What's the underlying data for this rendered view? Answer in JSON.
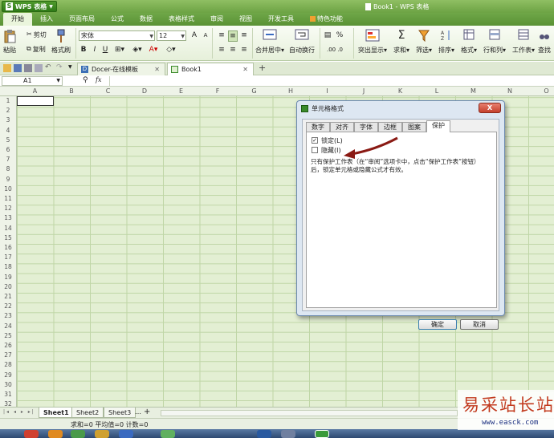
{
  "app": {
    "button_label": "WPS 表格",
    "window_title": "Book1 - WPS 表格"
  },
  "menu": [
    {
      "label": "开始"
    },
    {
      "label": "插入"
    },
    {
      "label": "页面布局"
    },
    {
      "label": "公式"
    },
    {
      "label": "数据"
    },
    {
      "label": "表格样式"
    },
    {
      "label": "审阅"
    },
    {
      "label": "视图"
    },
    {
      "label": "开发工具"
    },
    {
      "label": "特色功能"
    }
  ],
  "ribbon": {
    "paste": "粘贴",
    "cut": "剪切",
    "copy": "复制",
    "format_painter": "格式刷",
    "font_name": "宋体",
    "font_size": "12",
    "bold": "B",
    "italic": "I",
    "underline": "U",
    "merge": "合并居中",
    "wrap": "自动换行",
    "percent": "%",
    "conditional": "突出显示",
    "sum": "求和",
    "filter": "筛选",
    "sort": "排序",
    "format": "格式",
    "rowcol": "行和列",
    "sheet": "工作表",
    "find": "查找"
  },
  "tabs": [
    {
      "label": "Docer-在线模板"
    },
    {
      "label": "Book1"
    }
  ],
  "formula": {
    "name_box": "A1",
    "fx": "fx"
  },
  "columns": [
    "A",
    "B",
    "C",
    "D",
    "E",
    "F",
    "G",
    "H",
    "I",
    "J",
    "K",
    "L",
    "M",
    "N",
    "O"
  ],
  "rows": [
    "1",
    "2",
    "3",
    "4",
    "5",
    "6",
    "7",
    "8",
    "9",
    "10",
    "11",
    "12",
    "13",
    "14",
    "15",
    "16",
    "17",
    "18",
    "19",
    "20",
    "21",
    "22",
    "23",
    "24",
    "25",
    "26",
    "27",
    "28",
    "29",
    "30",
    "31",
    "32"
  ],
  "sheets": [
    {
      "label": "Sheet1"
    },
    {
      "label": "Sheet2"
    },
    {
      "label": "Sheet3"
    }
  ],
  "sheet_more": "…",
  "sheet_add": "+",
  "status": {
    "text": "求和=0  平均值=0  计数=0"
  },
  "dialog": {
    "title": "单元格格式",
    "close": "X",
    "tabs": [
      {
        "label": "数字"
      },
      {
        "label": "对齐"
      },
      {
        "label": "字体"
      },
      {
        "label": "边框"
      },
      {
        "label": "图案"
      },
      {
        "label": "保护"
      }
    ],
    "lock_label": "锁定(L)",
    "lock_checked": "✓",
    "hidden_label": "隐藏(I)",
    "note": "只有保护工作表（在“审阅”选项卡中，点击“保护工作表”按钮）后，锁定单元格或隐藏公式才有效。",
    "ok": "确定",
    "cancel": "取消"
  },
  "watermark": {
    "main": "易采站长站",
    "url": "www.easck.com"
  },
  "colors": {
    "accent_green": "#6da344",
    "grid": "#e3efd3",
    "arrow": "#8a1a14"
  }
}
